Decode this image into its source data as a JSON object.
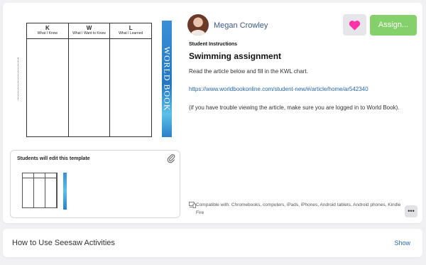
{
  "worksheet": {
    "columns": [
      {
        "letter": "K",
        "subtitle": "What I Know"
      },
      {
        "letter": "W",
        "subtitle": "What I Want to Know"
      },
      {
        "letter": "L",
        "subtitle": "What I Learned"
      }
    ],
    "logo_text": "WORLD BOOK"
  },
  "template": {
    "label": "Students will edit this template",
    "icon": "paperclip-icon"
  },
  "teacher": {
    "name": "Megan Crowley"
  },
  "actions": {
    "heart_icon": "heart-icon",
    "heart_color": "#ff33a8",
    "assign_label": "Assign...",
    "assign_color": "#84d06a",
    "more_label": "•••"
  },
  "instructions": {
    "label": "Student Instructions",
    "title": "Swimming assignment",
    "paragraph1": "Read the article below and fill in the KWL chart.",
    "link": "https://www.worldbookonline.com/student-new/#/article/home/ar542340",
    "paragraph2": "(if you have trouble viewing the article, make sure you are logged in to World Book)."
  },
  "compatibility": {
    "icon": "devices-icon",
    "text": "Compatible with: Chromebooks, computers, iPads, iPhones, Android tablets, Android phones, Kindle Fire"
  },
  "how_to": {
    "title": "How to Use Seesaw Activities",
    "toggle": "Show"
  }
}
